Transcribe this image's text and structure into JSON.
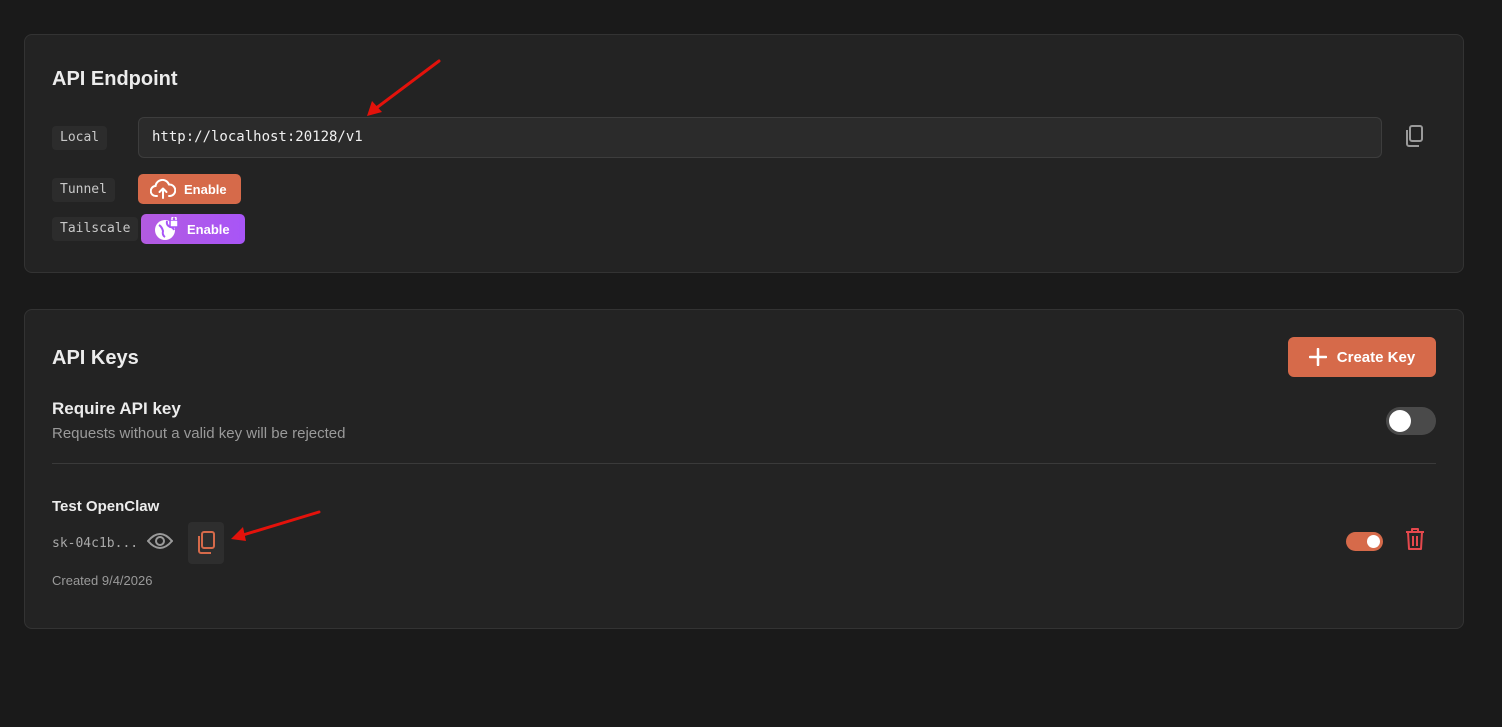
{
  "endpoint_card": {
    "title": "API Endpoint",
    "local_label": "Local",
    "local_url": "http://localhost:20128/v1",
    "tunnel_label": "Tunnel",
    "tunnel_button": "Enable",
    "tailscale_label": "Tailscale",
    "tailscale_button": "Enable"
  },
  "keys_card": {
    "title": "API Keys",
    "create_button": "Create Key",
    "require_title": "Require API key",
    "require_desc": "Requests without a valid key will be rejected",
    "require_enabled": false,
    "keys": [
      {
        "name": "Test OpenClaw",
        "value": "sk-04c1b...",
        "created": "Created 9/4/2026",
        "active": true
      }
    ]
  },
  "colors": {
    "accent": "#d66a4a",
    "tailscale": "#a855f7",
    "danger": "#e5484d",
    "annotation_arrow": "#e3120b"
  },
  "icons": [
    "copy-icon",
    "cloud-upload-icon",
    "globe-lock-icon",
    "plus-icon",
    "eye-icon",
    "trash-icon"
  ]
}
